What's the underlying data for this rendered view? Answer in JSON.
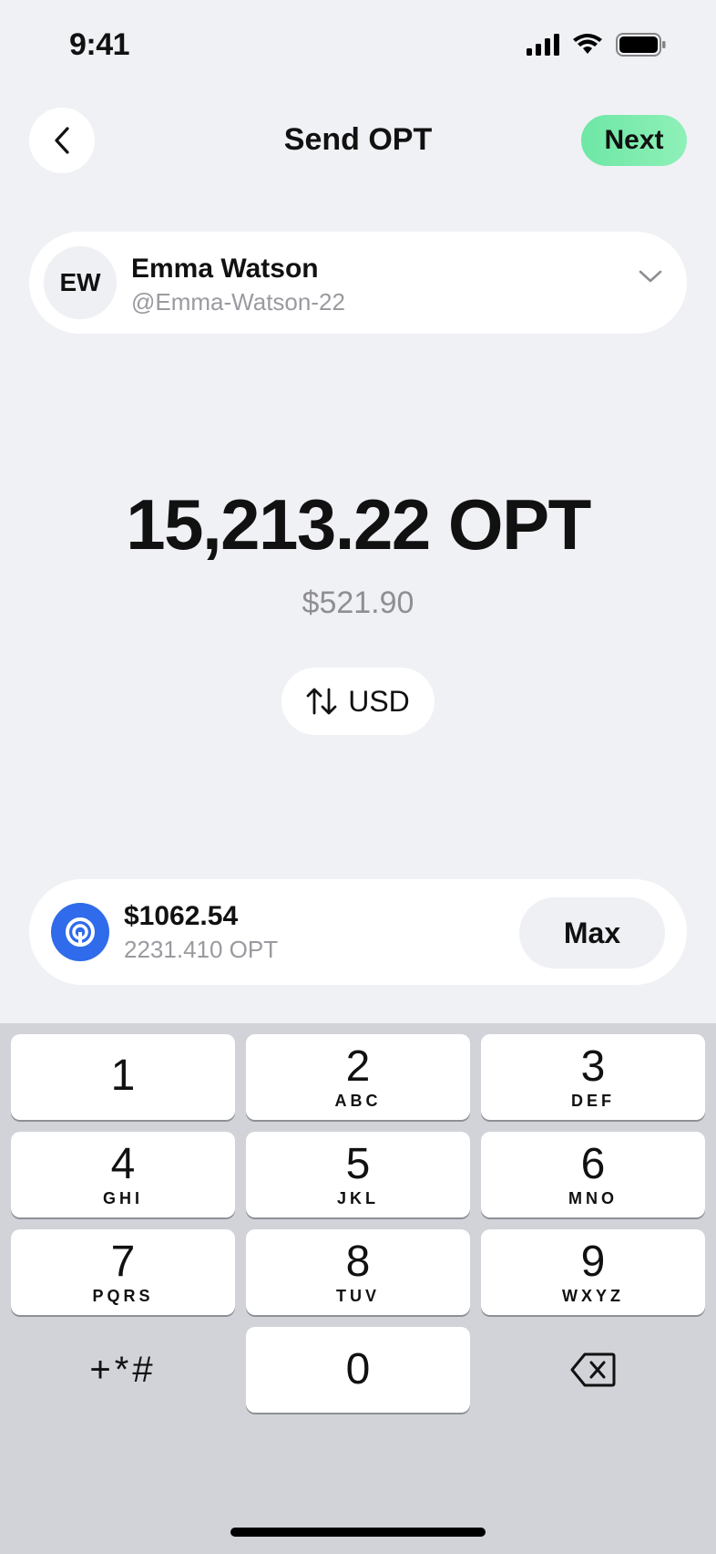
{
  "status_bar": {
    "time": "9:41"
  },
  "header": {
    "title": "Send OPT",
    "next_label": "Next"
  },
  "recipient": {
    "initials": "EW",
    "name": "Emma Watson",
    "handle": "@Emma-Watson-22"
  },
  "amount": {
    "value": "15,213.22 OPT",
    "fiat": "$521.90",
    "toggle_label": "USD"
  },
  "balance": {
    "fiat": "$1062.54",
    "token": "2231.410 OPT",
    "max_label": "Max"
  },
  "keypad": {
    "keys": [
      {
        "digit": "1",
        "letters": ""
      },
      {
        "digit": "2",
        "letters": "ABC"
      },
      {
        "digit": "3",
        "letters": "DEF"
      },
      {
        "digit": "4",
        "letters": "GHI"
      },
      {
        "digit": "5",
        "letters": "JKL"
      },
      {
        "digit": "6",
        "letters": "MNO"
      },
      {
        "digit": "7",
        "letters": "PQRS"
      },
      {
        "digit": "8",
        "letters": "TUV"
      },
      {
        "digit": "9",
        "letters": "WXYZ"
      },
      {
        "digit": "0",
        "letters": ""
      }
    ],
    "symbols_label": "+*#"
  },
  "colors": {
    "accent_green": "#6ee7a5",
    "token_blue": "#2f6bea",
    "background": "#f0f1f5"
  }
}
